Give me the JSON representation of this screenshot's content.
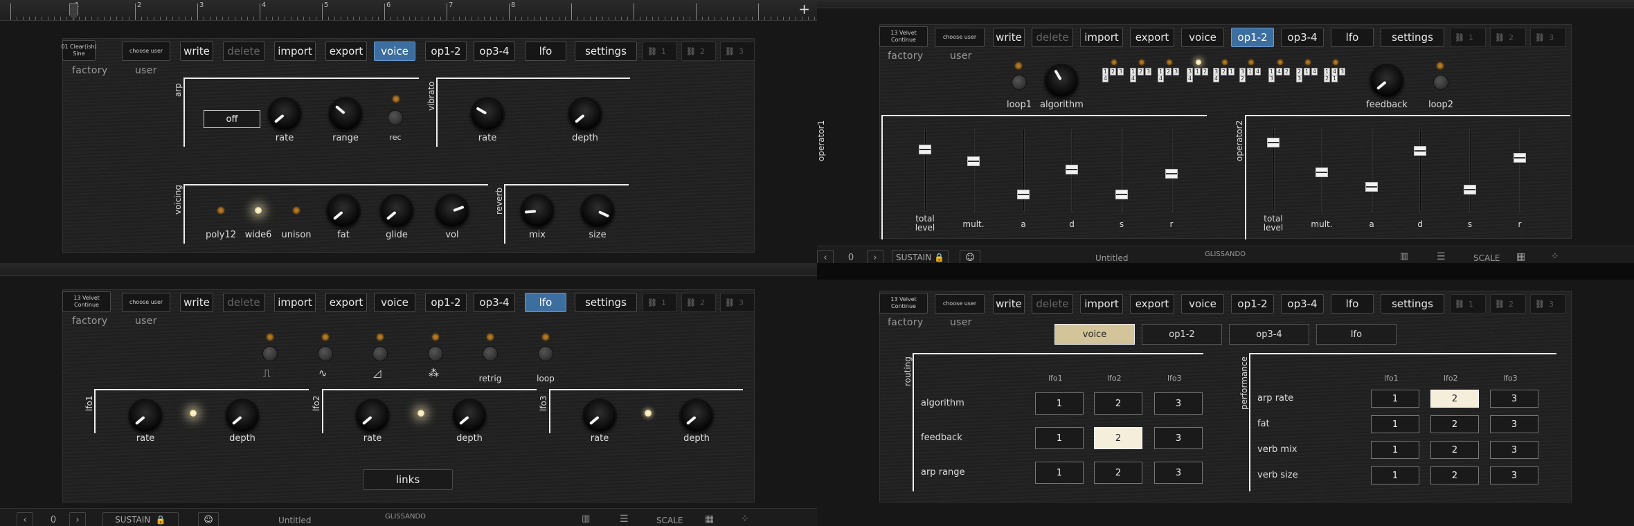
{
  "ruler": {
    "marks": [
      "1",
      "2",
      "3",
      "4",
      "5",
      "6",
      "7",
      "8"
    ],
    "plus": "+"
  },
  "toolbar": {
    "choose_user": "choose user",
    "write": "write",
    "delete": "delete",
    "import": "import",
    "export": "export",
    "voice": "voice",
    "op12": "op1-2",
    "op34": "op3-4",
    "lfo": "lfo",
    "settings": "settings",
    "link1": "1",
    "link2": "2",
    "link3": "3"
  },
  "presets": {
    "tl": [
      "01 Clear(ish)",
      "Sine"
    ],
    "other": [
      "13 Velvet",
      "Continue"
    ]
  },
  "banks": {
    "factory": "factory",
    "user": "user"
  },
  "voice_page": {
    "arp": {
      "title": "arp",
      "off": "off",
      "rate": "rate",
      "range": "range",
      "rec": "rec"
    },
    "vibrato": {
      "title": "vibrato",
      "rate": "rate",
      "depth": "depth"
    },
    "voicing": {
      "title": "voicing",
      "poly12": "poly12",
      "wide6": "wide6",
      "unison": "unison",
      "fat": "fat",
      "glide": "glide",
      "vol": "vol"
    },
    "reverb": {
      "title": "reverb",
      "mix": "mix",
      "size": "size"
    }
  },
  "op_page": {
    "loop1": "loop1",
    "algorithm": "algorithm",
    "feedback": "feedback",
    "loop2": "loop2",
    "algos": [
      "1 2 3 4",
      "1 2 3 4",
      "1 2 3 4",
      "3 1 2 4",
      "3 2 1 4",
      "3 1 4 2",
      "1 4 2 3",
      "2 1 4 3",
      "1 4 3 2 1"
    ],
    "operator1": "operator1",
    "operator2": "operator2",
    "fader_labels": [
      "total level",
      "mult.",
      "a",
      "d",
      "s",
      "r"
    ],
    "op1_levels": [
      0.78,
      0.62,
      0.17,
      0.51,
      0.17,
      0.45
    ],
    "op2_levels": [
      0.88,
      0.47,
      0.27,
      0.76,
      0.24,
      0.67
    ]
  },
  "lfo_page": {
    "shapes": [
      "⎍",
      "∿",
      "◿",
      "⁂"
    ],
    "retrig": "retrig",
    "loop": "loop",
    "lfo1": "lfo1",
    "lfo2": "lfo2",
    "lfo3": "lfo3",
    "rate": "rate",
    "depth": "depth",
    "links": "links"
  },
  "status": {
    "back": "‹",
    "value": "0",
    "fwd": "›",
    "sustain": "SUSTAIN",
    "title": "Untitled",
    "brand": "GLISSANDO",
    "scale": "SCALE"
  },
  "settings_page": {
    "tabs": [
      "voice",
      "op1-2",
      "op3-4",
      "lfo"
    ],
    "routing": "routing",
    "performance": "performance",
    "cols": [
      "lfo1",
      "lfo2",
      "lfo3"
    ],
    "routing_rows": [
      "algorithm",
      "feedback",
      "arp range"
    ],
    "routing_selected": [
      0,
      2,
      0
    ],
    "perf_rows": [
      "arp rate",
      "fat",
      "verb mix",
      "verb size"
    ],
    "perf_selected": [
      2,
      0,
      0,
      0
    ],
    "cell_values": [
      "1",
      "2",
      "3"
    ]
  },
  "colors": {
    "accent": "#3d6ea0",
    "selected_cell": "#f4eedb",
    "gold_tab": "#d4c49a",
    "led": "#c98a2a"
  }
}
